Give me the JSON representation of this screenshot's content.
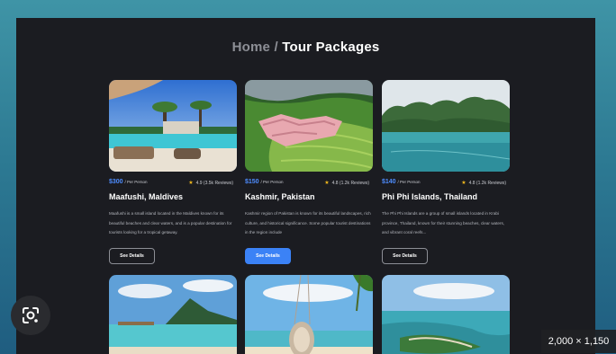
{
  "heading": {
    "crumb": "Home",
    "separator": "/",
    "current": "Tour Packages"
  },
  "cards": [
    {
      "price": "$300",
      "per": "/ Per Person",
      "rating": "4.9 (3.5k Reviews)",
      "name": "Maafushi, Maldives",
      "desc": "Maafushi is a small island located in the Maldives known for its beautiful beaches and clear waters, and is a popular destination for tourists looking for a tropical getaway.",
      "button": "See Details"
    },
    {
      "price": "$150",
      "per": "/ Per Person",
      "rating": "4.8 (1.2k Reviews)",
      "name": "Kashmir, Pakistan",
      "desc": "Kashmir region of Pakistan is known for its beautiful landscapes, rich culture, and historical significance. Some popular tourist destinations in the region include",
      "button": "See Details"
    },
    {
      "price": "$140",
      "per": "/ Per Person",
      "rating": "4.8 (1.2k Reviews)",
      "name": "Phi Phi Islands, Thailand",
      "desc": "The Phi Phi Islands are a group of small islands located in Krabi province, Thailand, known for their stunning beaches, clear waters, and vibrant coral reefs...",
      "button": "See Details"
    }
  ],
  "image_badge": "2,000 × 1,150",
  "icons": {
    "star": "star-icon",
    "lens": "google-lens-icon"
  },
  "colors": {
    "accent": "#3b82f6",
    "price": "#4e8dff",
    "star": "#f2b91d",
    "panel": "#1b1c21"
  }
}
